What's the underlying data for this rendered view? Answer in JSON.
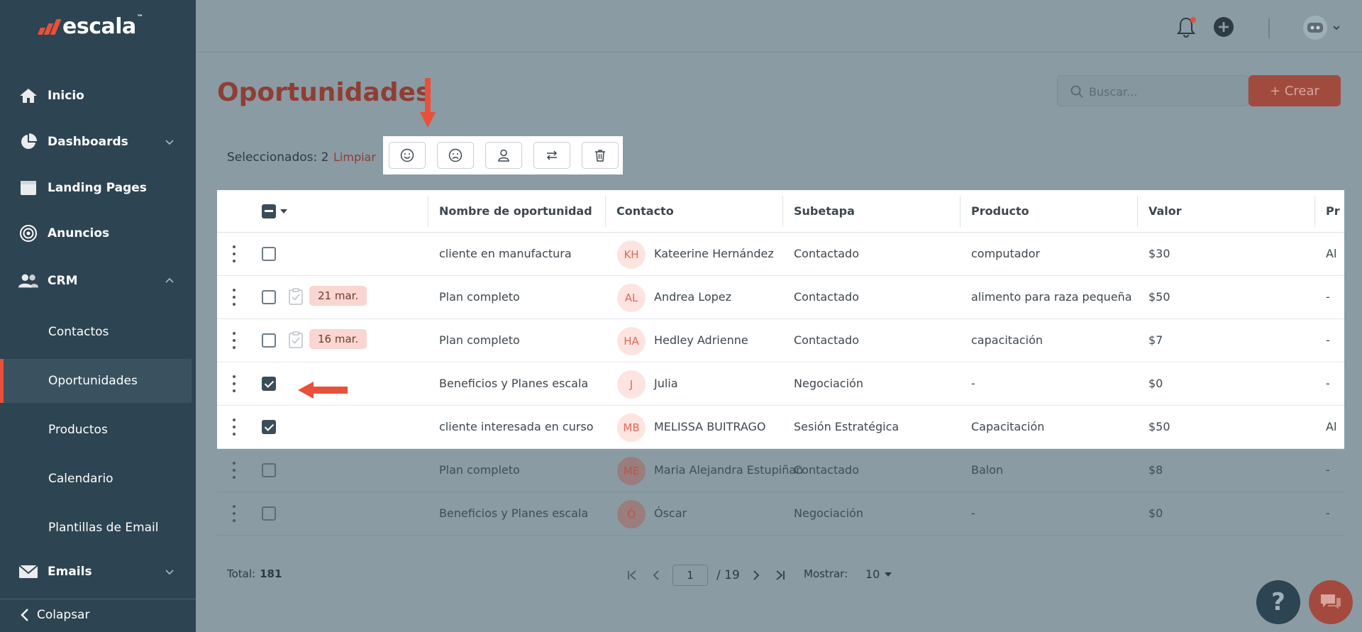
{
  "app": {
    "logo_text": "escala",
    "logo_tm": "™"
  },
  "sidebar": {
    "items": [
      {
        "label": "Inicio",
        "icon": "home-icon"
      },
      {
        "label": "Dashboards",
        "icon": "pie-chart-icon"
      },
      {
        "label": "Landing Pages",
        "icon": "browser-window-icon"
      },
      {
        "label": "Anuncios",
        "icon": "target-icon"
      },
      {
        "label": "CRM",
        "icon": "people-icon"
      },
      {
        "label": "Emails",
        "icon": "mail-icon"
      }
    ],
    "crm_subitems": [
      "Contactos",
      "Oportunidades",
      "Productos",
      "Calendario",
      "Plantillas de Email"
    ],
    "active": "Oportunidades",
    "collapse_label": "Colapsar"
  },
  "header": {
    "icons": [
      "bell-icon",
      "plus-circle-icon",
      "avatar"
    ]
  },
  "main": {
    "title": "Oportunidades",
    "search_placeholder": "Buscar...",
    "create_label": "+ Crear",
    "selection": {
      "label": "Seleccionados:",
      "count": "2",
      "clear_label": "Limpiar"
    },
    "bulk_actions": [
      "smile-icon",
      "sad-icon",
      "person-icon",
      "swap-icon",
      "trash-icon"
    ]
  },
  "table": {
    "columns": [
      "Nombre de oportunidad",
      "Contacto",
      "Subetapa",
      "Producto",
      "Valor",
      "Pr"
    ],
    "rows": [
      {
        "name": "cliente en manufactura",
        "initials": "KH",
        "contact": "Kateerine Hernández",
        "subetapa": "Contactado",
        "producto": "computador",
        "valor": "$30",
        "extra": "Al",
        "checked": false,
        "date": ""
      },
      {
        "name": "Plan completo",
        "initials": "AL",
        "contact": "Andrea Lopez",
        "subetapa": "Contactado",
        "producto": "alimento para raza pequeña",
        "valor": "$50",
        "extra": "-",
        "checked": false,
        "date": "21 mar."
      },
      {
        "name": "Plan completo",
        "initials": "HA",
        "contact": "Hedley Adrienne",
        "subetapa": "Contactado",
        "producto": "capacitación",
        "valor": "$7",
        "extra": "-",
        "checked": false,
        "date": "16 mar."
      },
      {
        "name": "Beneficios y Planes escala",
        "initials": "J",
        "contact": "Julia",
        "subetapa": "Negociación",
        "producto": "-",
        "valor": "$0",
        "extra": "-",
        "checked": true,
        "date": ""
      },
      {
        "name": "cliente interesada en curso",
        "initials": "MB",
        "contact": "MELISSA BUITRAGO",
        "subetapa": "Sesión Estratégica",
        "producto": "Capacitación",
        "valor": "$50",
        "extra": "Al",
        "checked": true,
        "date": ""
      },
      {
        "name": "Plan completo",
        "initials": "ME",
        "contact": "Maria Alejandra Estupiñan",
        "subetapa": "Contactado",
        "producto": "Balon",
        "valor": "$8",
        "extra": "-",
        "checked": false,
        "date": ""
      },
      {
        "name": "Beneficios y Planes escala",
        "initials": "Ó",
        "contact": "Óscar",
        "subetapa": "Negociación",
        "producto": "-",
        "valor": "$0",
        "extra": "-",
        "checked": false,
        "date": ""
      }
    ]
  },
  "footer": {
    "total_label": "Total:",
    "total_value": "181",
    "page_current": "1",
    "page_total": "/ 19",
    "show_label": "Mostrar:",
    "show_value": "10"
  },
  "colors": {
    "accent": "#e8503a",
    "sidebar": "#2d4452",
    "title": "#8f3e33"
  }
}
